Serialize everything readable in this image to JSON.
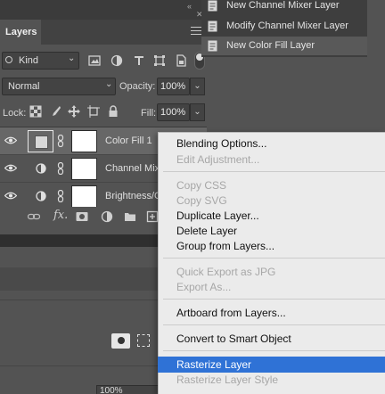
{
  "layers_panel": {
    "tab_label": "Layers",
    "filter": {
      "kind_label": "Kind"
    },
    "blend": {
      "mode": "Normal",
      "opacity_label": "Opacity:",
      "opacity_value": "100%"
    },
    "lock": {
      "lock_label": "Lock:",
      "fill_label": "Fill:",
      "fill_value": "100%"
    },
    "layers": [
      {
        "name": "Color Fill 1",
        "selected": true,
        "type": "color-fill"
      },
      {
        "name": "Channel Mix",
        "selected": false,
        "type": "adjustment"
      },
      {
        "name": "Brightness/C",
        "selected": false,
        "type": "adjustment"
      }
    ]
  },
  "previous_menu": {
    "items": [
      {
        "label": "New Channel Mixer Layer",
        "selected": false
      },
      {
        "label": "Modify Channel Mixer Layer",
        "selected": false
      },
      {
        "label": "New Color Fill Layer",
        "selected": true
      }
    ]
  },
  "context_menu": {
    "items": [
      {
        "label": "Blending Options...",
        "enabled": true
      },
      {
        "label": "Edit Adjustment...",
        "enabled": false
      },
      {
        "label": "Copy CSS",
        "enabled": false
      },
      {
        "label": "Copy SVG",
        "enabled": false
      },
      {
        "label": "Duplicate Layer...",
        "enabled": true
      },
      {
        "label": "Delete Layer",
        "enabled": true
      },
      {
        "label": "Group from Layers...",
        "enabled": true
      },
      {
        "label": "Quick Export as JPG",
        "enabled": false
      },
      {
        "label": "Export As...",
        "enabled": false
      },
      {
        "label": "Artboard from Layers...",
        "enabled": true
      },
      {
        "label": "Convert to Smart Object",
        "enabled": true
      },
      {
        "label": "Rasterize Layer",
        "enabled": true,
        "highlighted": true
      },
      {
        "label": "Rasterize Layer Style",
        "enabled": false
      }
    ]
  },
  "lower_panel": {
    "zoom_value": "100%"
  },
  "colors": {
    "highlight": "#2f72d6",
    "panel_bg": "#535353",
    "menu_bg": "#ebebeb",
    "disabled_text": "#a7a7a7"
  }
}
